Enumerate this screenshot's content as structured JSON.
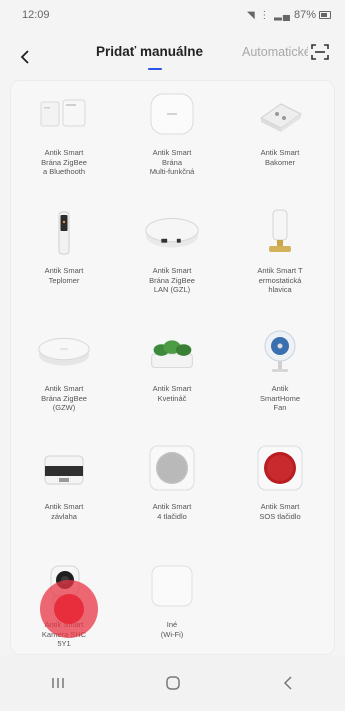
{
  "status": {
    "time": "12:09",
    "battery": "87%"
  },
  "header": {
    "tab_add": "Pridať manuálne",
    "tab_auto": "Automatické"
  },
  "devices": [
    {
      "label": "Antik Smart\nBrána ZigBee\na Bluethooth",
      "icon": "gateway-bt-icon"
    },
    {
      "label": "Antik Smart\nBrána\nMulti-funkčná",
      "icon": "multi-gateway-icon"
    },
    {
      "label": "Antik Smart\nBakomer",
      "icon": "bakomer-icon"
    },
    {
      "label": "Antik Smart\nTeplomer",
      "icon": "thermometer-icon"
    },
    {
      "label": "Antik Smart\nBrána ZigBee\nLAN (GZL)",
      "icon": "gateway-lan-icon"
    },
    {
      "label": "Antik Smart T\nermostatická\nhlavica",
      "icon": "thermostat-head-icon"
    },
    {
      "label": "Antik Smart\nBrána ZigBee\n(GZW)",
      "icon": "gateway-gzw-icon"
    },
    {
      "label": "Antik Smart\nKvetináč",
      "icon": "planter-icon"
    },
    {
      "label": "Antik\nSmartHome\nFan",
      "icon": "fan-icon"
    },
    {
      "label": "Antik Smart\nzávlaha",
      "icon": "irrigation-icon"
    },
    {
      "label": "Antik Smart\n4 tlačidlo",
      "icon": "four-button-icon"
    },
    {
      "label": "Antik Smart\nSOS tlačidlo",
      "icon": "sos-button-icon"
    },
    {
      "label": "Antik Smart\nKamera SHC\n5Y1",
      "icon": "camera-icon"
    },
    {
      "label": "Iné\n(Wi-Fi)",
      "icon": "wifi-other-icon"
    }
  ]
}
